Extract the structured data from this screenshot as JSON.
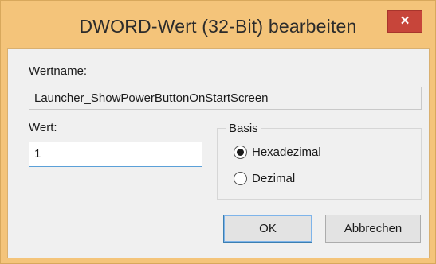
{
  "window": {
    "title": "DWORD-Wert (32-Bit) bearbeiten",
    "close_symbol": "×"
  },
  "value_name": {
    "label": "Wertname:",
    "value": "Launcher_ShowPowerButtonOnStartScreen"
  },
  "value_data": {
    "label": "Wert:",
    "value": "1"
  },
  "basis": {
    "legend": "Basis",
    "options": [
      {
        "label": "Hexadezimal",
        "selected": true
      },
      {
        "label": "Dezimal",
        "selected": false
      }
    ]
  },
  "buttons": {
    "ok": "OK",
    "cancel": "Abbrechen"
  },
  "colors": {
    "frame": "#f4c47a",
    "close_button": "#c7453a",
    "focus_border": "#5ba0d8"
  }
}
